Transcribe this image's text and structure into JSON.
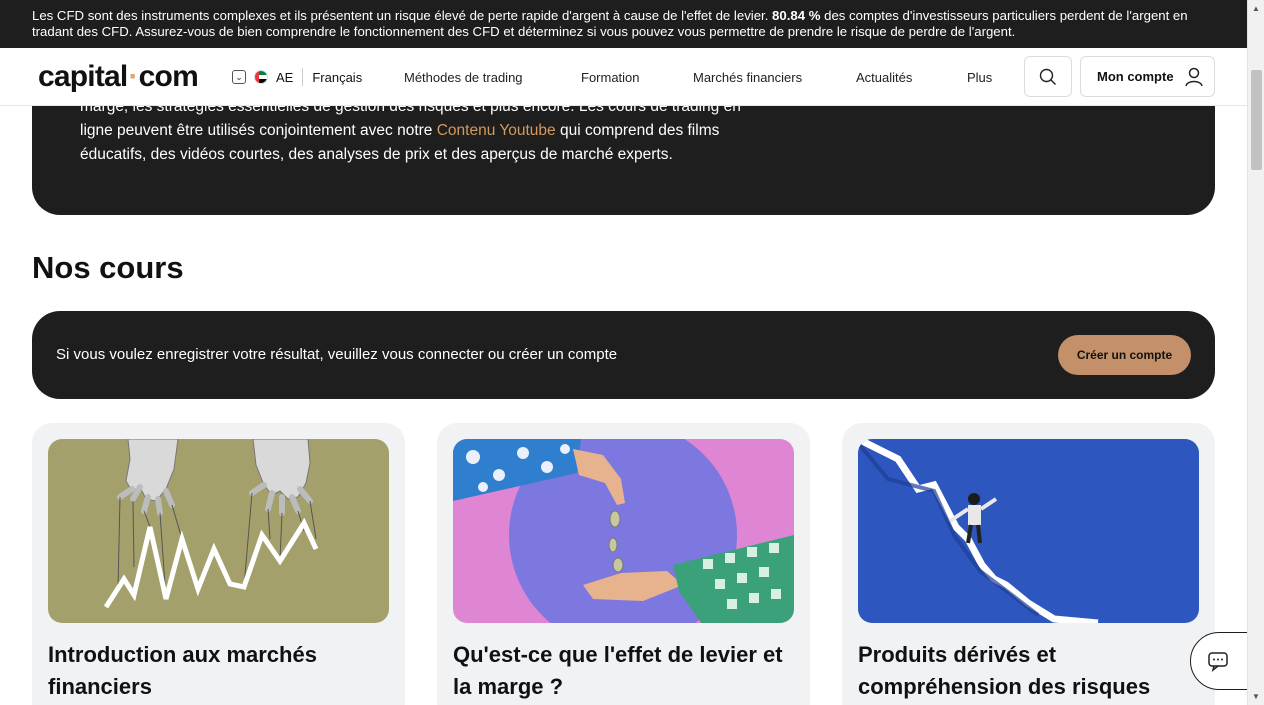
{
  "risk_warning": {
    "text_before": "Les CFD sont des instruments complexes et ils présentent un risque élevé de perte rapide d'argent à cause de l'effet de levier. ",
    "percent": "80.84 %",
    "text_after": " des comptes d'investisseurs particuliers perdent de l'argent en tradant des CFD. Assurez-vous de bien comprendre le fonctionnement des CFD et déterminez si vous pouvez vous permettre de prendre le risque de perdre de l'argent."
  },
  "header": {
    "logo_left": "capital",
    "logo_dot": "·",
    "logo_right": "com",
    "region": "AE",
    "language": "Français",
    "menu": [
      "Méthodes de trading",
      "Formation",
      "Marchés financiers",
      "Actualités",
      "Plus"
    ],
    "account_label": "Mon compte"
  },
  "intro": {
    "line1": "marge, les stratégies essentielles de gestion des risques et plus encore. Les cours de trading en",
    "line2_before": "ligne peuvent être utilisés conjointement avec notre ",
    "line2_link": "Contenu Youtube",
    "line2_after": " qui comprend des films",
    "line3": "éducatifs, des vidéos courtes, des analyses de prix et des aperçus de marché experts."
  },
  "courses": {
    "heading": "Nos cours",
    "cta_text": "Si vous voulez enregistrer votre résultat, veuillez vous connecter ou créer un compte",
    "cta_button": "Créer un compte",
    "cards": [
      {
        "title": "Introduction aux marchés financiers"
      },
      {
        "title": "Qu'est-ce que l'effet de levier et la marge ?"
      },
      {
        "title": "Produits dérivés et compréhension des risques"
      }
    ]
  },
  "colors": {
    "dark_bg": "#1e1e1e",
    "accent": "#c4906a",
    "link": "#d29a5e",
    "card_bg": "#f1f2f4"
  },
  "icons": [
    "chevron-down-icon",
    "uae-flag-icon",
    "search-icon",
    "user-icon",
    "chat-icon"
  ]
}
